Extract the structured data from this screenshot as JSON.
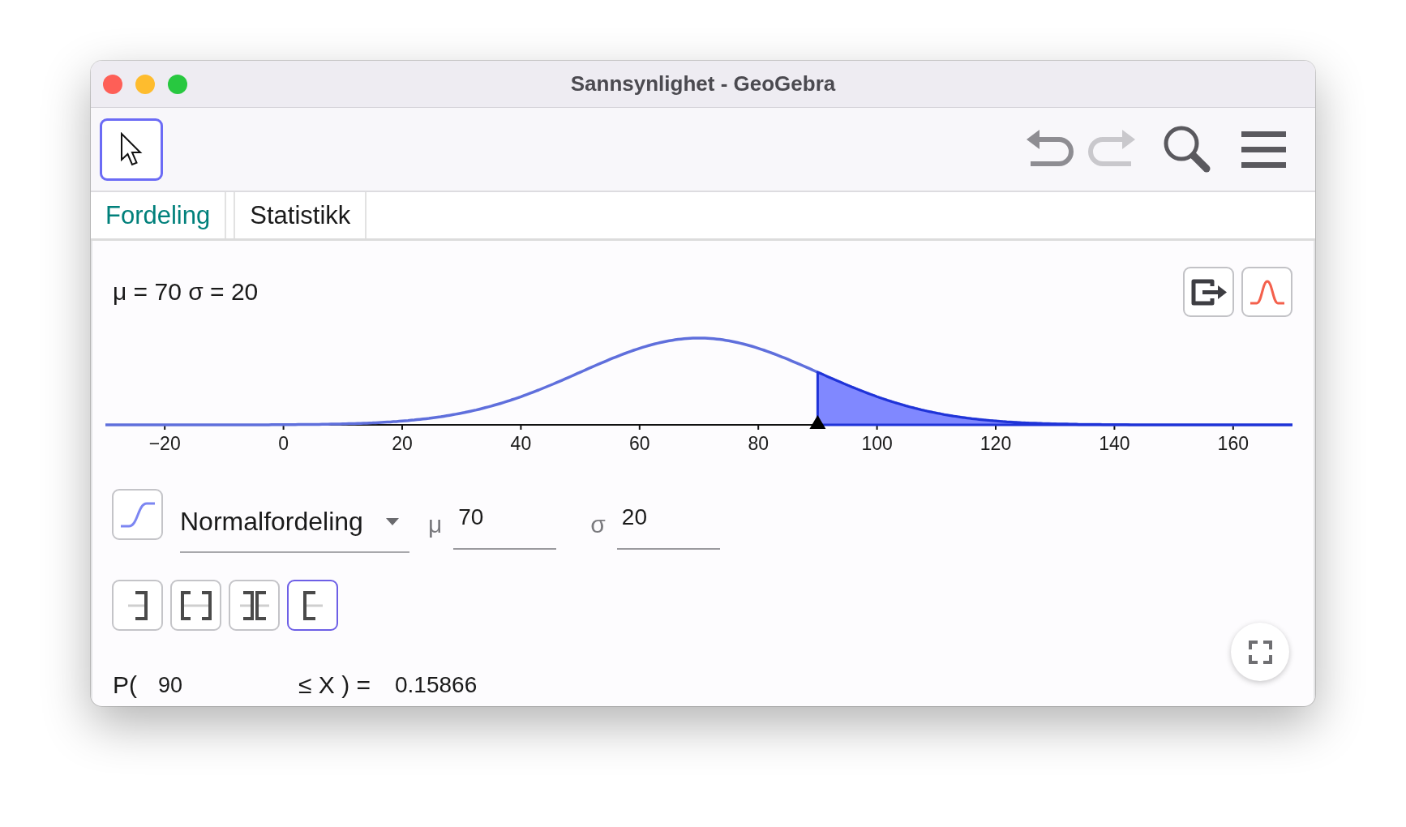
{
  "window": {
    "title": "Sannsynlighet - GeoGebra"
  },
  "toolbar": {
    "tools": [
      {
        "kind": "move",
        "selected": true
      }
    ],
    "undo": {
      "disabled": false
    },
    "redo": {
      "disabled": true
    }
  },
  "tabs": [
    {
      "label": "Fordeling",
      "selected": true
    },
    {
      "label": "Statistikk",
      "selected": false
    }
  ],
  "graph": {
    "label": "μ = 70 σ = 20",
    "axis_ticks": [
      "−20",
      "0",
      "20",
      "40",
      "60",
      "80",
      "100",
      "120",
      "140",
      "160"
    ]
  },
  "distribution": {
    "cumulative_toggle": {
      "selected": false
    },
    "type": "Normalfordeling",
    "parameters": [
      {
        "symbol": "μ",
        "value": "70"
      },
      {
        "symbol": "σ",
        "value": "20"
      }
    ]
  },
  "interval_modes": [
    {
      "kind": "left_sided",
      "selected": false
    },
    {
      "kind": "interval",
      "selected": false
    },
    {
      "kind": "two_sided",
      "selected": false
    },
    {
      "kind": "right_sided",
      "selected": true
    }
  ],
  "probability": {
    "prefix": "P(",
    "lower_bound": "90",
    "relation": "≤ X ) =",
    "result": "0.15866"
  }
}
